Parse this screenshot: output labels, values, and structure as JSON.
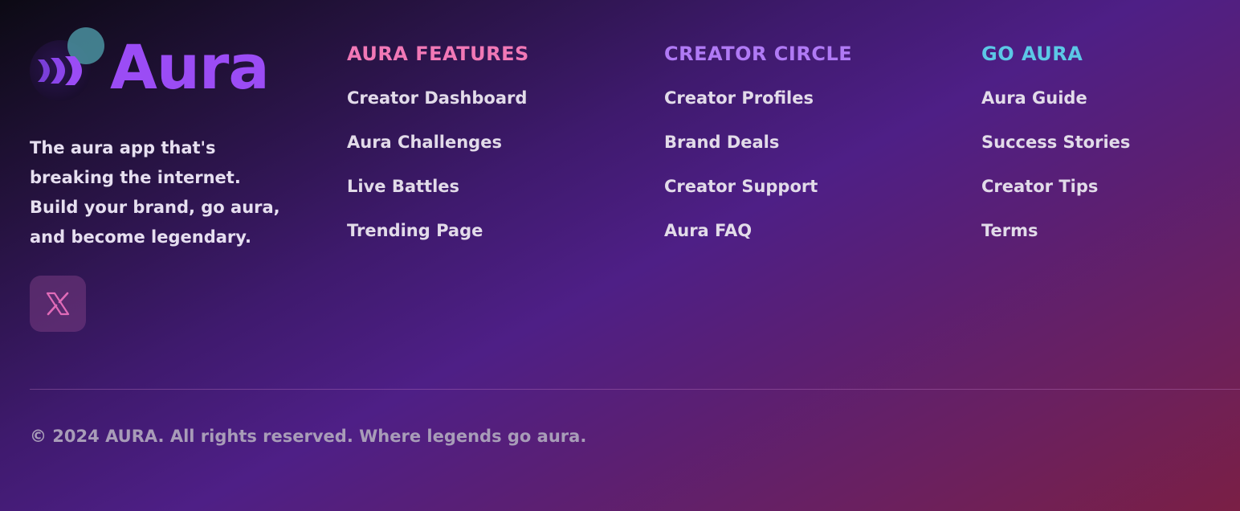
{
  "brand": {
    "name": "Aura",
    "tagline": "The aura app that's breaking the internet. Build your brand, go aura, and become legendary.",
    "logo_icon": "aura-waves-icon",
    "social": [
      {
        "icon": "x-icon",
        "glyph": "𝕏"
      }
    ]
  },
  "columns": [
    {
      "title": "AURA FEATURES",
      "color": "#f178b6",
      "links": [
        "Creator Dashboard",
        "Aura Challenges",
        "Live Battles",
        "Trending Page"
      ]
    },
    {
      "title": "CREATOR CIRCLE",
      "color": "#b07af5",
      "links": [
        "Creator Profiles",
        "Brand Deals",
        "Creator Support",
        "Aura FAQ"
      ]
    },
    {
      "title": "GO AURA",
      "color": "#5cc8e6",
      "links": [
        "Aura Guide",
        "Success Stories",
        "Creator Tips",
        "Terms"
      ]
    }
  ],
  "copyright": "© 2024 AURA. All rights reserved. Where legends go aura.",
  "colors": {
    "brand_purple": "#9b4cf5",
    "social_x_pink": "#e06bb8"
  }
}
